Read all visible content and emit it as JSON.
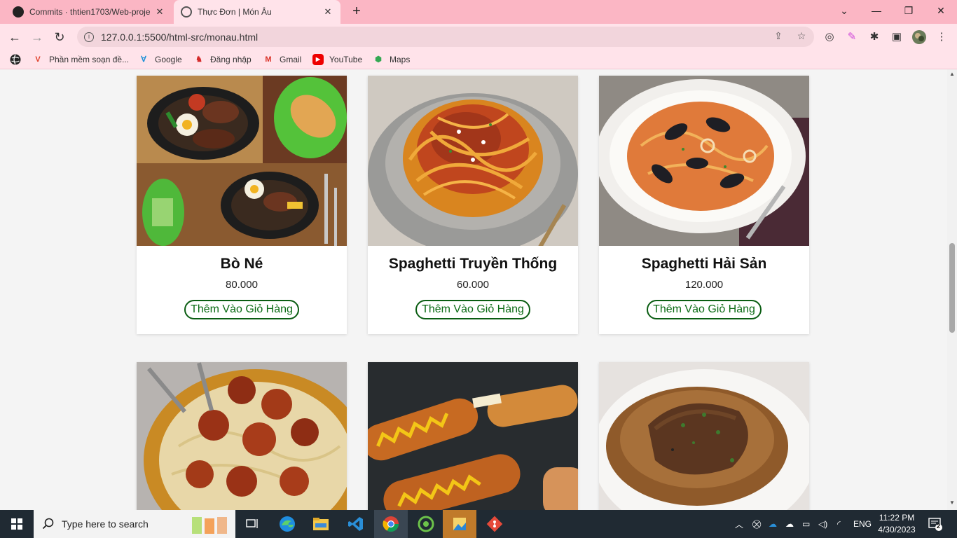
{
  "browser": {
    "tabs": [
      {
        "title": "Commits · thtien1703/Web-proje",
        "active": false
      },
      {
        "title": "Thực Đơn | Món Âu",
        "active": true
      }
    ],
    "new_tab_label": "+",
    "url": "127.0.0.1:5500/html-src/monau.html",
    "bookmarks": [
      {
        "label": "Phần mềm soạn đề..."
      },
      {
        "label": "Google"
      },
      {
        "label": "Đăng nhập"
      },
      {
        "label": "Gmail"
      },
      {
        "label": "YouTube"
      },
      {
        "label": "Maps"
      }
    ]
  },
  "menu": {
    "items": [
      {
        "name": "Bò Né",
        "price": "80.000",
        "button": "Thêm Vào Giỏ Hàng"
      },
      {
        "name": "Spaghetti Truyền Thống",
        "price": "60.000",
        "button": "Thêm Vào Giỏ Hàng"
      },
      {
        "name": "Spaghetti Hải Sản",
        "price": "120.000",
        "button": "Thêm Vào Giỏ Hàng"
      }
    ]
  },
  "taskbar": {
    "search_placeholder": "Type here to search",
    "language": "ENG",
    "time": "11:22 PM",
    "date": "4/30/2023",
    "notifications": "2"
  },
  "colors": {
    "tabbar": "#fbb6c4",
    "toolbar": "#ffe3ea",
    "button_border": "#0a5d12",
    "taskbar": "#202a33"
  }
}
